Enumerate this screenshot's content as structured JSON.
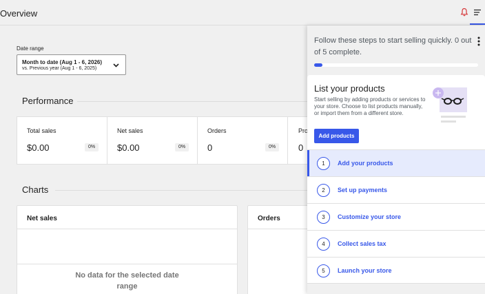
{
  "header": {
    "title": "Overview",
    "icons": [
      "bell-icon",
      "menu-icon"
    ],
    "accent_color": "#3858e9"
  },
  "date_range": {
    "label": "Date range",
    "line1": "Month to date (Aug 1 - 6, 2026)",
    "line2": "vs. Previous year (Aug 1 - 6, 2025)"
  },
  "performance": {
    "title": "Performance",
    "metrics": [
      {
        "name": "Total sales",
        "value": "$0.00",
        "change": "0%"
      },
      {
        "name": "Net sales",
        "value": "$0.00",
        "change": "0%"
      },
      {
        "name": "Orders",
        "value": "0",
        "change": "0%"
      },
      {
        "name": "Pro",
        "value": "0",
        "change": ""
      }
    ]
  },
  "charts": {
    "title": "Charts",
    "cards": [
      {
        "title": "Net sales",
        "empty_line1": "No data for the selected date",
        "empty_line2": "range"
      },
      {
        "title": "Orders",
        "empty_line1": "",
        "empty_line2": ""
      }
    ]
  },
  "setup_panel": {
    "intro": "Follow these steps to start selling quickly. 0 out of 5 complete.",
    "progress": 0.05,
    "task": {
      "title": "List your products",
      "description": "Start selling by adding products or services to your store. Choose to list products manually, or import them from a different store.",
      "button": "Add products"
    },
    "steps": [
      {
        "num": "1",
        "label": "Add your products",
        "active": true
      },
      {
        "num": "2",
        "label": "Set up payments",
        "active": false
      },
      {
        "num": "3",
        "label": "Customize your store",
        "active": false
      },
      {
        "num": "4",
        "label": "Collect sales tax",
        "active": false
      },
      {
        "num": "5",
        "label": "Launch your store",
        "active": false
      }
    ]
  }
}
